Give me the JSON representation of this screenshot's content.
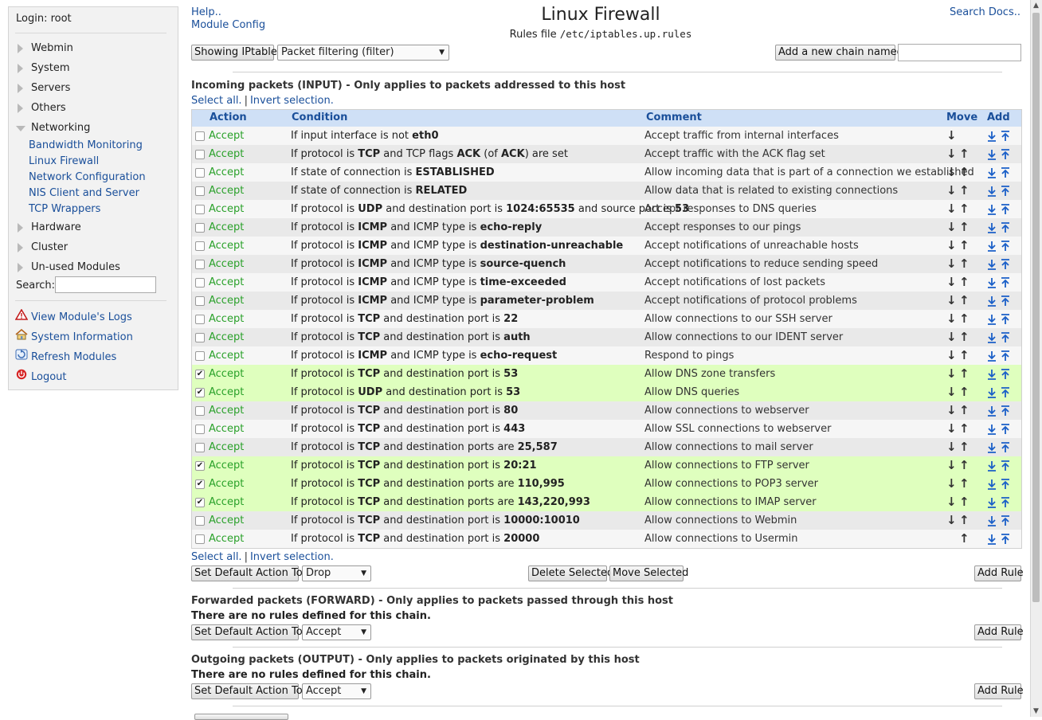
{
  "sidebar": {
    "login": "Login: root",
    "categories": {
      "webmin": "Webmin",
      "system": "System",
      "servers": "Servers",
      "others": "Others",
      "networking": "Networking",
      "hardware": "Hardware",
      "cluster": "Cluster",
      "unused": "Un-used Modules"
    },
    "networking_items": {
      "bandwidth": "Bandwidth Monitoring",
      "firewall": "Linux Firewall",
      "netconfig": "Network Configuration",
      "nis": "NIS Client and Server",
      "tcpwrappers": "TCP Wrappers"
    },
    "search_label": "Search:",
    "search_value": "",
    "links": {
      "logs": "View Module's Logs",
      "sysinfo": "System Information",
      "refresh": "Refresh Modules",
      "logout": "Logout"
    }
  },
  "header": {
    "help": "Help..",
    "module_config": "Module Config",
    "title": "Linux Firewall",
    "rules_file_label": "Rules file",
    "rules_file_path": "/etc/iptables.up.rules",
    "search_docs": "Search Docs.."
  },
  "toolbar": {
    "showing_label": "Showing IPtable:",
    "table_selected": "Packet filtering (filter)",
    "add_chain_label": "Add a new chain named:",
    "add_chain_value": ""
  },
  "input_chain": {
    "title": "Incoming packets (INPUT) - Only applies to packets addressed to this host",
    "select_all": "Select all.",
    "invert": "Invert selection.",
    "columns": {
      "action": "Action",
      "condition": "Condition",
      "comment": "Comment",
      "move": "Move",
      "add": "Add"
    },
    "rows": [
      {
        "checked": false,
        "action": "Accept",
        "cond": [
          [
            "If input interface is not ",
            ""
          ],
          [
            "eth0",
            "b"
          ]
        ],
        "comment": "Accept traffic from internal interfaces",
        "down": true,
        "up": false
      },
      {
        "checked": false,
        "action": "Accept",
        "cond": [
          [
            "If protocol is ",
            ""
          ],
          [
            "TCP",
            "b"
          ],
          [
            " and TCP flags ",
            ""
          ],
          [
            "ACK",
            "b"
          ],
          [
            " (of ",
            ""
          ],
          [
            "ACK",
            "b"
          ],
          [
            ") are set",
            ""
          ]
        ],
        "comment": "Accept traffic with the ACK flag set",
        "down": true,
        "up": true
      },
      {
        "checked": false,
        "action": "Accept",
        "cond": [
          [
            "If state of connection is ",
            ""
          ],
          [
            "ESTABLISHED",
            "b"
          ]
        ],
        "comment": "Allow incoming data that is part of a connection we established",
        "down": true,
        "up": true
      },
      {
        "checked": false,
        "action": "Accept",
        "cond": [
          [
            "If state of connection is ",
            ""
          ],
          [
            "RELATED",
            "b"
          ]
        ],
        "comment": "Allow data that is related to existing connections",
        "down": true,
        "up": true
      },
      {
        "checked": false,
        "action": "Accept",
        "cond": [
          [
            "If protocol is ",
            ""
          ],
          [
            "UDP",
            "b"
          ],
          [
            " and destination port is ",
            ""
          ],
          [
            "1024:65535",
            "b"
          ],
          [
            " and source port is ",
            ""
          ],
          [
            "53",
            "b"
          ]
        ],
        "comment": "Accept responses to DNS queries",
        "down": true,
        "up": true
      },
      {
        "checked": false,
        "action": "Accept",
        "cond": [
          [
            "If protocol is ",
            ""
          ],
          [
            "ICMP",
            "b"
          ],
          [
            " and ICMP type is ",
            ""
          ],
          [
            "echo-reply",
            "b"
          ]
        ],
        "comment": "Accept responses to our pings",
        "down": true,
        "up": true
      },
      {
        "checked": false,
        "action": "Accept",
        "cond": [
          [
            "If protocol is ",
            ""
          ],
          [
            "ICMP",
            "b"
          ],
          [
            " and ICMP type is ",
            ""
          ],
          [
            "destination-unreachable",
            "b"
          ]
        ],
        "comment": "Accept notifications of unreachable hosts",
        "down": true,
        "up": true
      },
      {
        "checked": false,
        "action": "Accept",
        "cond": [
          [
            "If protocol is ",
            ""
          ],
          [
            "ICMP",
            "b"
          ],
          [
            " and ICMP type is ",
            ""
          ],
          [
            "source-quench",
            "b"
          ]
        ],
        "comment": "Accept notifications to reduce sending speed",
        "down": true,
        "up": true
      },
      {
        "checked": false,
        "action": "Accept",
        "cond": [
          [
            "If protocol is ",
            ""
          ],
          [
            "ICMP",
            "b"
          ],
          [
            " and ICMP type is ",
            ""
          ],
          [
            "time-exceeded",
            "b"
          ]
        ],
        "comment": "Accept notifications of lost packets",
        "down": true,
        "up": true
      },
      {
        "checked": false,
        "action": "Accept",
        "cond": [
          [
            "If protocol is ",
            ""
          ],
          [
            "ICMP",
            "b"
          ],
          [
            " and ICMP type is ",
            ""
          ],
          [
            "parameter-problem",
            "b"
          ]
        ],
        "comment": "Accept notifications of protocol problems",
        "down": true,
        "up": true
      },
      {
        "checked": false,
        "action": "Accept",
        "cond": [
          [
            "If protocol is ",
            ""
          ],
          [
            "TCP",
            "b"
          ],
          [
            " and destination port is ",
            ""
          ],
          [
            "22",
            "b"
          ]
        ],
        "comment": "Allow connections to our SSH server",
        "down": true,
        "up": true
      },
      {
        "checked": false,
        "action": "Accept",
        "cond": [
          [
            "If protocol is ",
            ""
          ],
          [
            "TCP",
            "b"
          ],
          [
            " and destination port is ",
            ""
          ],
          [
            "auth",
            "b"
          ]
        ],
        "comment": "Allow connections to our IDENT server",
        "down": true,
        "up": true
      },
      {
        "checked": false,
        "action": "Accept",
        "cond": [
          [
            "If protocol is ",
            ""
          ],
          [
            "ICMP",
            "b"
          ],
          [
            " and ICMP type is ",
            ""
          ],
          [
            "echo-request",
            "b"
          ]
        ],
        "comment": "Respond to pings",
        "down": true,
        "up": true
      },
      {
        "checked": true,
        "action": "Accept",
        "cond": [
          [
            "If protocol is ",
            ""
          ],
          [
            "TCP",
            "b"
          ],
          [
            " and destination port is ",
            ""
          ],
          [
            "53",
            "b"
          ]
        ],
        "comment": "Allow DNS zone transfers",
        "down": true,
        "up": true
      },
      {
        "checked": true,
        "action": "Accept",
        "cond": [
          [
            "If protocol is ",
            ""
          ],
          [
            "UDP",
            "b"
          ],
          [
            " and destination port is ",
            ""
          ],
          [
            "53",
            "b"
          ]
        ],
        "comment": "Allow DNS queries",
        "down": true,
        "up": true
      },
      {
        "checked": false,
        "action": "Accept",
        "cond": [
          [
            "If protocol is ",
            ""
          ],
          [
            "TCP",
            "b"
          ],
          [
            " and destination port is ",
            ""
          ],
          [
            "80",
            "b"
          ]
        ],
        "comment": "Allow connections to webserver",
        "down": true,
        "up": true
      },
      {
        "checked": false,
        "action": "Accept",
        "cond": [
          [
            "If protocol is ",
            ""
          ],
          [
            "TCP",
            "b"
          ],
          [
            " and destination port is ",
            ""
          ],
          [
            "443",
            "b"
          ]
        ],
        "comment": "Allow SSL connections to webserver",
        "down": true,
        "up": true
      },
      {
        "checked": false,
        "action": "Accept",
        "cond": [
          [
            "If protocol is ",
            ""
          ],
          [
            "TCP",
            "b"
          ],
          [
            " and destination ports are ",
            ""
          ],
          [
            "25,587",
            "b"
          ]
        ],
        "comment": "Allow connections to mail server",
        "down": true,
        "up": true
      },
      {
        "checked": true,
        "action": "Accept",
        "cond": [
          [
            "If protocol is ",
            ""
          ],
          [
            "TCP",
            "b"
          ],
          [
            " and destination port is ",
            ""
          ],
          [
            "20:21",
            "b"
          ]
        ],
        "comment": "Allow connections to FTP server",
        "down": true,
        "up": true
      },
      {
        "checked": true,
        "action": "Accept",
        "cond": [
          [
            "If protocol is ",
            ""
          ],
          [
            "TCP",
            "b"
          ],
          [
            " and destination ports are ",
            ""
          ],
          [
            "110,995",
            "b"
          ]
        ],
        "comment": "Allow connections to POP3 server",
        "down": true,
        "up": true
      },
      {
        "checked": true,
        "action": "Accept",
        "cond": [
          [
            "If protocol is ",
            ""
          ],
          [
            "TCP",
            "b"
          ],
          [
            " and destination ports are ",
            ""
          ],
          [
            "143,220,993",
            "b"
          ]
        ],
        "comment": "Allow connections to IMAP server",
        "down": true,
        "up": true
      },
      {
        "checked": false,
        "action": "Accept",
        "cond": [
          [
            "If protocol is ",
            ""
          ],
          [
            "TCP",
            "b"
          ],
          [
            " and destination port is ",
            ""
          ],
          [
            "10000:10010",
            "b"
          ]
        ],
        "comment": "Allow connections to Webmin",
        "down": true,
        "up": true
      },
      {
        "checked": false,
        "action": "Accept",
        "cond": [
          [
            "If protocol is ",
            ""
          ],
          [
            "TCP",
            "b"
          ],
          [
            " and destination port is ",
            ""
          ],
          [
            "20000",
            "b"
          ]
        ],
        "comment": "Allow connections to Usermin",
        "down": false,
        "up": true
      }
    ],
    "default_action_label": "Set Default Action To:",
    "default_action": "Drop",
    "delete_selected": "Delete Selected",
    "move_selected": "Move Selected",
    "add_rule": "Add Rule"
  },
  "forward_chain": {
    "title": "Forwarded packets (FORWARD) - Only applies to packets passed through this host",
    "no_rules": "There are no rules defined for this chain.",
    "default_action_label": "Set Default Action To:",
    "default_action": "Accept",
    "add_rule": "Add Rule"
  },
  "output_chain": {
    "title": "Outgoing packets (OUTPUT) - Only applies to packets originated by this host",
    "no_rules": "There are no rules defined for this chain.",
    "default_action_label": "Set Default Action To:",
    "default_action": "Accept",
    "add_rule": "Add Rule"
  },
  "colors": {
    "link": "#1a4f9a",
    "accept_green": "#2aa12a",
    "header_blue": "#cfe0f6",
    "selected_row": "#dfffbe"
  },
  "icons": {
    "move_down": "down-arrow-icon",
    "move_up": "up-arrow-icon",
    "add_before": "add-before-icon",
    "add_after": "add-after-icon"
  }
}
